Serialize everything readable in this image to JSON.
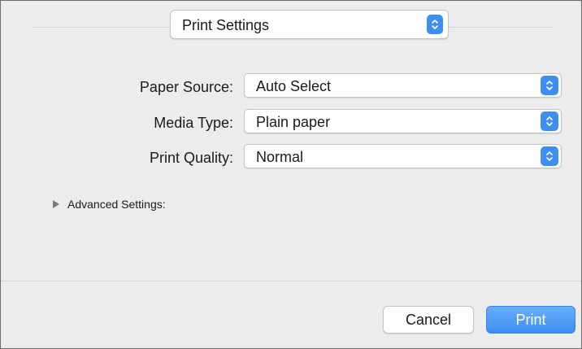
{
  "panel_selector": {
    "value": "Print Settings"
  },
  "form": {
    "rows": [
      {
        "label": "Paper Source:",
        "value": "Auto Select"
      },
      {
        "label": "Media Type:",
        "value": "Plain paper"
      },
      {
        "label": "Print Quality:",
        "value": "Normal"
      }
    ]
  },
  "advanced": {
    "label": "Advanced Settings:",
    "expanded": false
  },
  "buttons": {
    "cancel": "Cancel",
    "print": "Print"
  },
  "colors": {
    "accent": "#3d8ef0",
    "background": "#ececec"
  },
  "icons": {
    "stepper": "up-down-chevrons-icon",
    "disclosure": "disclosure-triangle-right-icon"
  }
}
